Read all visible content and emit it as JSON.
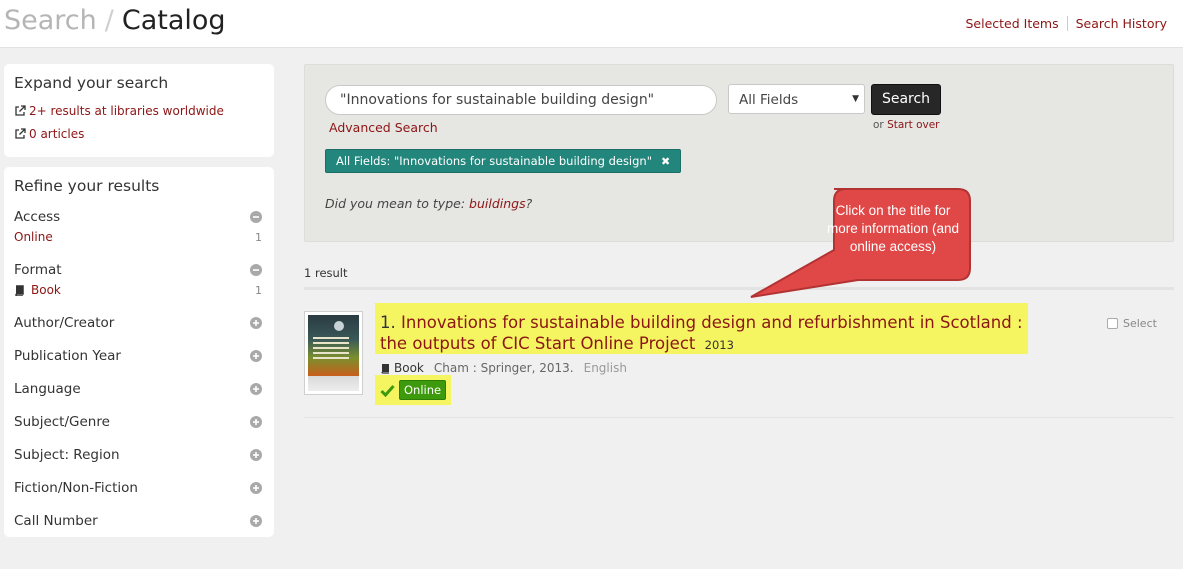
{
  "header": {
    "brand_search": "Search",
    "brand_sep": "/",
    "brand_catalog": "Catalog",
    "links": [
      "Selected Items",
      "Search History"
    ]
  },
  "expand": {
    "title": "Expand your search",
    "links": [
      "2+ results at libraries worldwide",
      "0 articles"
    ]
  },
  "refine": {
    "title": "Refine your results",
    "facets": [
      {
        "name": "Access",
        "value": "Online",
        "count": "1"
      },
      {
        "name": "Format",
        "value": "Book",
        "count": "1"
      },
      {
        "name": "Author/Creator"
      },
      {
        "name": "Publication Year"
      },
      {
        "name": "Language"
      },
      {
        "name": "Subject/Genre"
      },
      {
        "name": "Subject: Region"
      },
      {
        "name": "Fiction/Non-Fiction"
      },
      {
        "name": "Call Number"
      }
    ]
  },
  "search": {
    "query": "\"Innovations for sustainable building design\"",
    "field": "All Fields",
    "button": "Search",
    "advanced": "Advanced Search",
    "or": "or",
    "start_over": "Start over",
    "chip": "All Fields: \"Innovations for sustainable building design\"",
    "did_you_mean_prefix": "Did you mean to type:",
    "did_you_mean_word": "buildings",
    "did_you_mean_suffix": "?"
  },
  "results": {
    "count": "1 result",
    "items": [
      {
        "number": "1.",
        "title": "Innovations for sustainable building design and refurbishment in Scotland : the outputs of CIC Start Online Project",
        "year": "2013",
        "format": "Book",
        "publisher": "Cham : Springer, 2013.",
        "language": "English",
        "access": "Online",
        "select_label": "Select"
      }
    ]
  },
  "callout": {
    "text": "Click on the title for more information (and online access)",
    "fill": "#e04747",
    "stroke": "#b33333"
  },
  "colors": {
    "link": "#8c1515",
    "highlight": "#f5f562",
    "chip": "#23867c",
    "online": "#3d9a0c"
  }
}
